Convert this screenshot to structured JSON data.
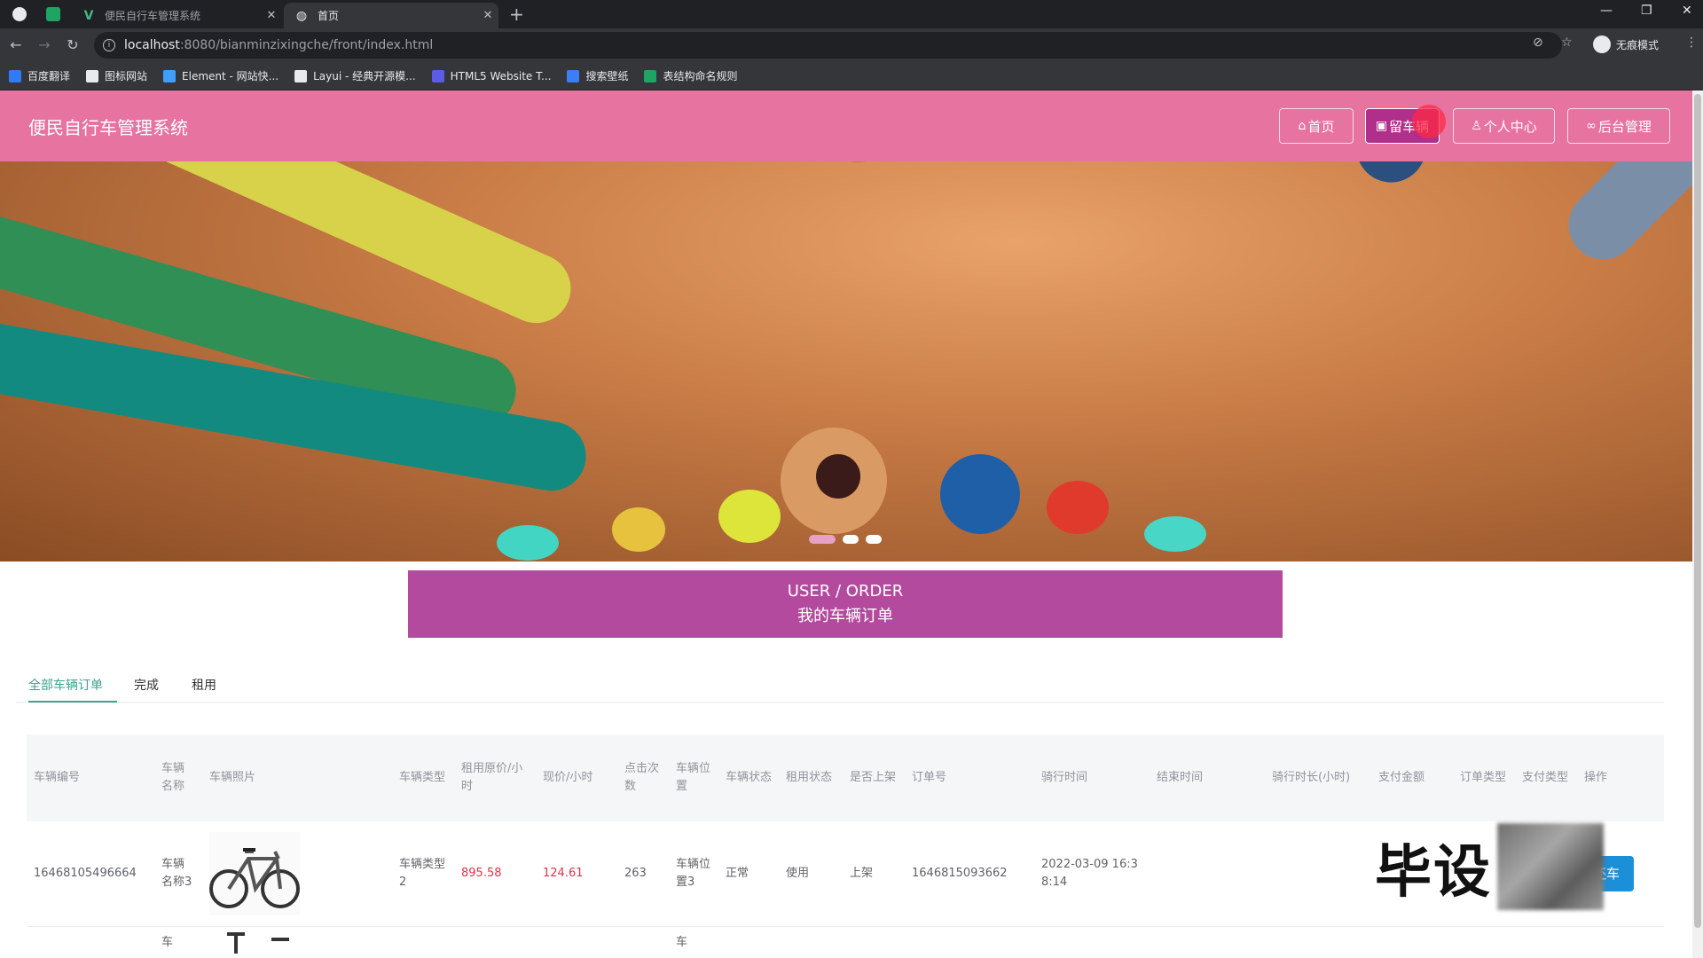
{
  "browser": {
    "tabs": [
      {
        "title": "便民自行车管理系统",
        "active": false
      },
      {
        "title": "首页",
        "active": true
      }
    ],
    "url_host": "localhost",
    "url_path": ":8080/bianminzixingche/front/index.html",
    "incognito_label": "无痕模式",
    "bookmarks": [
      {
        "label": "百度翻译",
        "icon": "translate-icon",
        "color": "#2f7cf6"
      },
      {
        "label": "图标网站",
        "icon": "flag-icon",
        "color": "#e8eaed"
      },
      {
        "label": "Element - 网站快...",
        "icon": "element-icon",
        "color": "#409eff"
      },
      {
        "label": "Layui - 经典开源模...",
        "icon": "layui-icon",
        "color": "#e8eaed"
      },
      {
        "label": "HTML5 Website T...",
        "icon": "html5-icon",
        "color": "#5b5be6"
      },
      {
        "label": "搜索壁纸",
        "icon": "wallpaper-icon",
        "color": "#3b7ff5"
      },
      {
        "label": "表结构命名规则",
        "icon": "doc-icon",
        "color": "#1fa463"
      }
    ]
  },
  "site": {
    "title": "便民自行车管理系统",
    "header_color": "#e673a0",
    "nav": [
      {
        "label": "首页",
        "icon": "home-icon",
        "active": false
      },
      {
        "label": "留车辆",
        "icon": "bike-icon",
        "active": true
      },
      {
        "label": "个人中心",
        "icon": "user-icon",
        "active": false
      },
      {
        "label": "后台管理",
        "icon": "link-icon",
        "active": false
      }
    ],
    "carousel_slides": 3,
    "carousel_active_index": 0
  },
  "section": {
    "title_en": "USER / ORDER",
    "title_cn": "我的车辆订单",
    "color": "#b44a9e"
  },
  "order_tabs": [
    {
      "label": "全部车辆订单",
      "active": true
    },
    {
      "label": "完成",
      "active": false
    },
    {
      "label": "租用",
      "active": false
    }
  ],
  "table": {
    "columns": [
      "车辆编号",
      "车辆名称",
      "车辆照片",
      "车辆类型",
      "租用原价/小时",
      "现价/小时",
      "点击次数",
      "车辆位置",
      "车辆状态",
      "租用状态",
      "是否上架",
      "订单号",
      "骑行时间",
      "结束时间",
      "骑行时长(小时)",
      "支付金额",
      "订单类型",
      "支付类型",
      "操作"
    ],
    "rows": [
      {
        "vehicle_no": "16468105496664",
        "name": "车辆名称3",
        "photo": "bike-photo",
        "type": "车辆类型2",
        "orig_price": "895.58",
        "cur_price": "124.61",
        "clicks": "263",
        "location": "车辆位置3",
        "status": "正常",
        "rent_status": "使用",
        "on_shelf": "上架",
        "order_no": "1646815093662",
        "ride_time": "2022-03-09 16:38:14",
        "end_time": "",
        "duration": "",
        "amount": "",
        "order_type": "",
        "pay_type": "",
        "action": "还车"
      },
      {
        "name": "车",
        "location": "车"
      }
    ]
  },
  "overlay": {
    "watermark_text": "毕设"
  }
}
